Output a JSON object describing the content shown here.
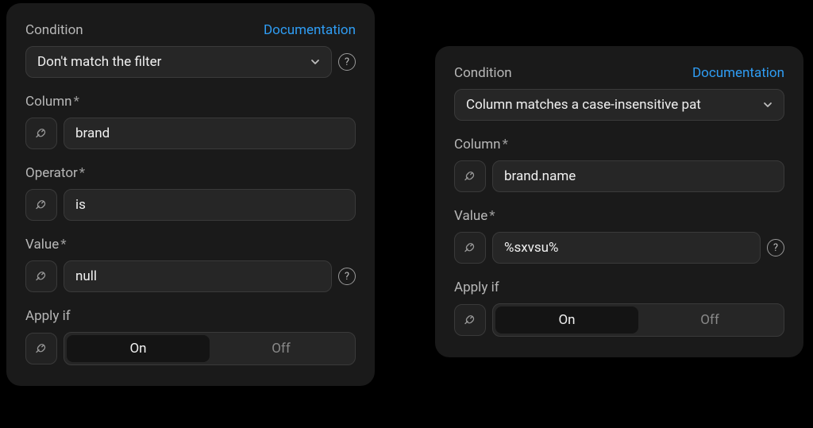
{
  "labels": {
    "condition": "Condition",
    "documentation": "Documentation",
    "column": "Column",
    "operator": "Operator",
    "value": "Value",
    "apply_if": "Apply if",
    "required_mark": "*",
    "help": "?"
  },
  "toggle": {
    "on": "On",
    "off": "Off"
  },
  "panels": [
    {
      "condition_value": "Don't match the filter",
      "column_value": "brand",
      "operator_value": "is",
      "value_value": "null",
      "value_has_help": true,
      "has_operator": true,
      "apply_if_active": "on"
    },
    {
      "condition_value": "Column matches a case-insensitive pat",
      "column_value": "brand.name",
      "operator_value": "",
      "value_value": "%sxvsu%",
      "value_has_help": true,
      "has_operator": false,
      "apply_if_active": "on"
    }
  ]
}
